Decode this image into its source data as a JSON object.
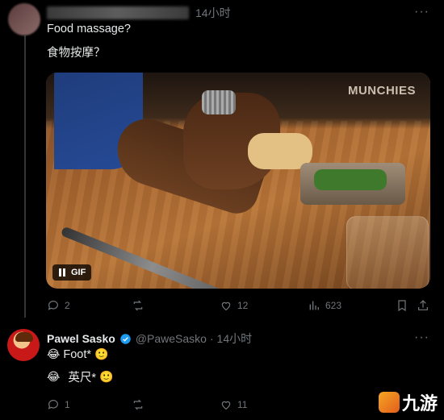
{
  "post": {
    "time": "14小时",
    "line1": "Food massage?",
    "line2": "食物按摩？",
    "media": {
      "watermark": "MUNCHIES",
      "badge": "GIF"
    },
    "actions": {
      "replies": "2",
      "likes": "12",
      "views": "623"
    }
  },
  "reply": {
    "name": "Pawel Sasko",
    "handle": "@PaweSasko",
    "time": "· 14小时",
    "line1_text": "Foot*",
    "line2_text": "英尺*",
    "emoji_laugh": "😂",
    "emoji_smile": "🙂",
    "actions": {
      "replies": "1",
      "likes": "11"
    }
  },
  "logo": {
    "text": "九游"
  },
  "colors": {
    "background": "#000000",
    "text": "#e7e9ea",
    "muted": "#71767b",
    "verified": "#1d9bf0"
  }
}
